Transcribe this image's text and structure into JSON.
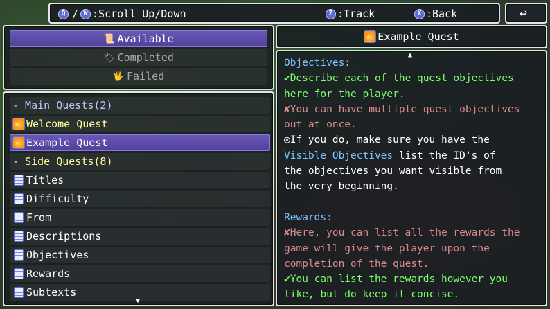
{
  "help": {
    "q_glyph": "Q",
    "slash": "/",
    "w_glyph": "W",
    "scroll_label": ":Scroll Up/Down",
    "z_glyph": "Z",
    "track_label": ":Track",
    "x_glyph": "X",
    "back_label": ":Back"
  },
  "back_button": {
    "glyph": "↩"
  },
  "categories": [
    {
      "icon": "📜",
      "label": "Available"
    },
    {
      "icon": "🏷",
      "label": "Completed"
    },
    {
      "icon": "🖐",
      "label": "Failed"
    }
  ],
  "quest_list": {
    "main_header": "- Main Quests(2)",
    "main": [
      "Welcome Quest",
      "Example Quest"
    ],
    "side_header": "- Side Quests(8)",
    "side": [
      "Titles",
      "Difficulty",
      "From",
      "Descriptions",
      "Objectives",
      "Rewards",
      "Subtexts"
    ]
  },
  "detail": {
    "title": "Example Quest",
    "objectives_header": "Objectives:",
    "obj_line1": "✔Describe each of the quest objectives",
    "obj_line2": "here for the player.",
    "obj_line3": "✘You can have multiple quest objectives",
    "obj_line4": "out at once.",
    "obj_line5": "◎If you do, make sure you have the",
    "obj_line6a": "Visible Objectives",
    "obj_line6b": " list the ID's of",
    "obj_line7": "the objectives you want visible from",
    "obj_line8": "the very beginning.",
    "rewards_header": "Rewards:",
    "rew_line1": "✘Here, you can list all the rewards the",
    "rew_line2": "game will give the player upon the",
    "rew_line3": "completion of the quest.",
    "rew_line4": "✔You can list the rewards however you",
    "rew_line5": "like, but do keep it concise."
  },
  "colors": {
    "selection": "#5a4aa8",
    "header_blue": "#7cc4ff",
    "green": "#7dff6a",
    "red": "#d88a8a",
    "yellow": "#ffff9a"
  }
}
